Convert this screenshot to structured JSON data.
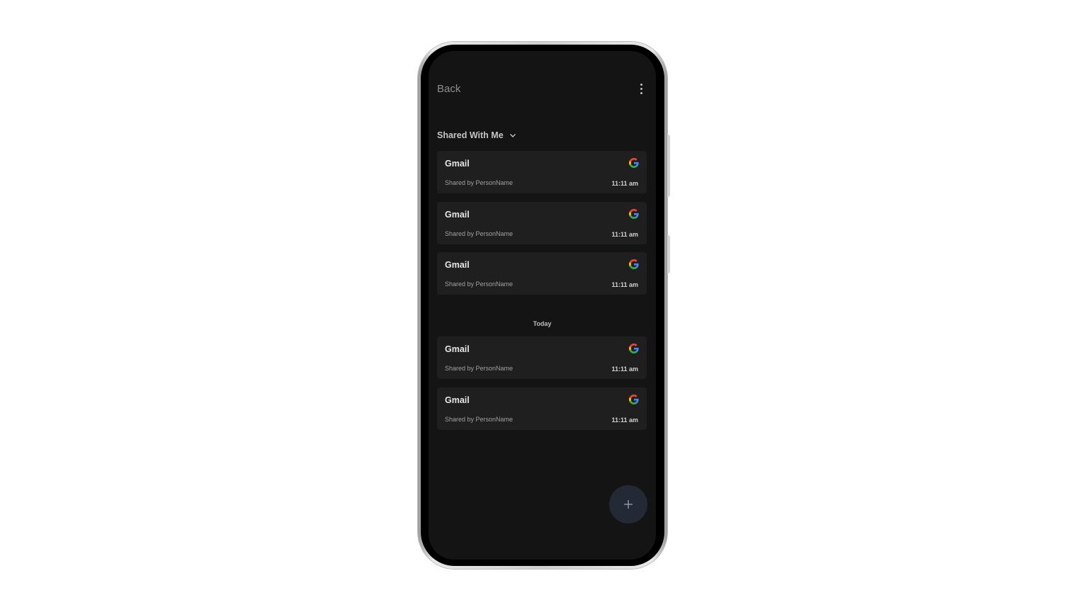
{
  "header": {
    "back_label": "Back",
    "menu_icon": "more-vert-icon"
  },
  "filter": {
    "label": "Shared With Me",
    "icon": "chevron-down-icon"
  },
  "items_top": [
    {
      "title": "Gmail",
      "subtitle": "Shared by PersonName",
      "time": "11:11 am",
      "icon": "google-icon"
    },
    {
      "title": "Gmail",
      "subtitle": "Shared by PersonName",
      "time": "11:11 am",
      "icon": "google-icon"
    },
    {
      "title": "Gmail",
      "subtitle": "Shared by PersonName",
      "time": "11:11 am",
      "icon": "google-icon"
    }
  ],
  "section": {
    "label": "Today"
  },
  "items_today": [
    {
      "title": "Gmail",
      "subtitle": "Shared by PersonName",
      "time": "11:11 am",
      "icon": "google-icon"
    },
    {
      "title": "Gmail",
      "subtitle": "Shared by PersonName",
      "time": "11:11 am",
      "icon": "google-icon"
    }
  ],
  "fab": {
    "icon": "plus-icon"
  },
  "colors": {
    "screen_bg": "#141414",
    "card_bg": "#1f1f1f",
    "fab_bg": "#232a36",
    "google_blue": "#4285F4",
    "google_red": "#EA4335",
    "google_yellow": "#FBBC05",
    "google_green": "#34A853"
  }
}
